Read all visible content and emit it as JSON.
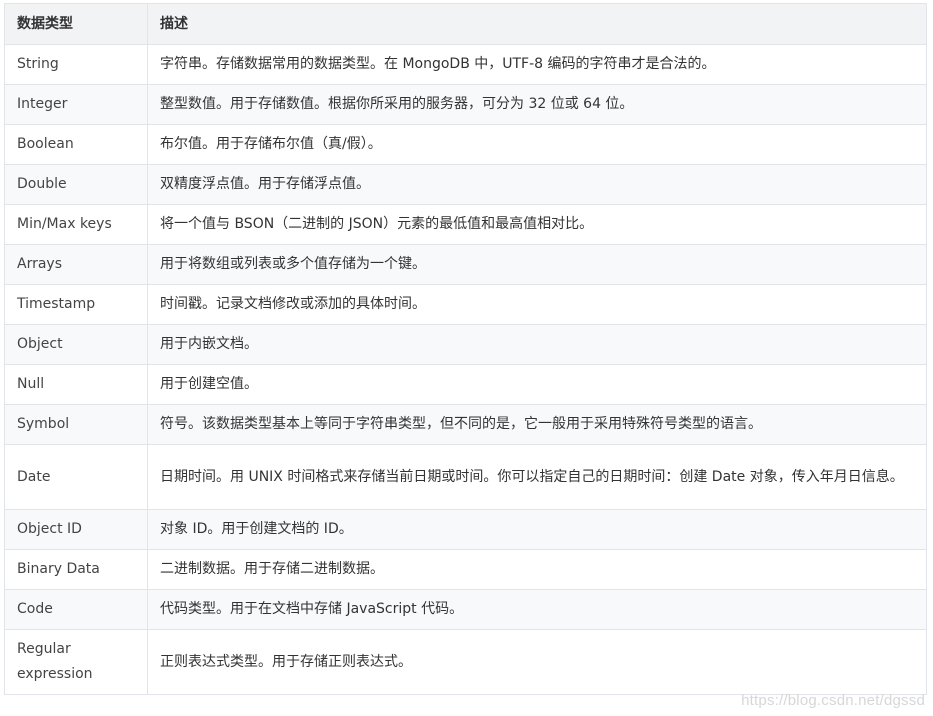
{
  "table": {
    "headers": [
      "数据类型",
      "描述"
    ],
    "rows": [
      {
        "type": "String",
        "desc": "字符串。存储数据常用的数据类型。在 MongoDB 中，UTF-8 编码的字符串才是合法的。"
      },
      {
        "type": "Integer",
        "desc": "整型数值。用于存储数值。根据你所采用的服务器，可分为 32 位或 64 位。"
      },
      {
        "type": "Boolean",
        "desc": "布尔值。用于存储布尔值（真/假）。"
      },
      {
        "type": "Double",
        "desc": "双精度浮点值。用于存储浮点值。"
      },
      {
        "type": "Min/Max keys",
        "desc": "将一个值与 BSON（二进制的 JSON）元素的最低值和最高值相对比。"
      },
      {
        "type": "Arrays",
        "desc": "用于将数组或列表或多个值存储为一个键。"
      },
      {
        "type": "Timestamp",
        "desc": "时间戳。记录文档修改或添加的具体时间。"
      },
      {
        "type": "Object",
        "desc": "用于内嵌文档。"
      },
      {
        "type": "Null",
        "desc": "用于创建空值。"
      },
      {
        "type": "Symbol",
        "desc": "符号。该数据类型基本上等同于字符串类型，但不同的是，它一般用于采用特殊符号类型的语言。"
      },
      {
        "type": "Date",
        "desc": "日期时间。用 UNIX 时间格式来存储当前日期或时间。你可以指定自己的日期时间：创建 Date 对象，传入年月日信息。"
      },
      {
        "type": "Object ID",
        "desc": "对象 ID。用于创建文档的 ID。"
      },
      {
        "type": "Binary Data",
        "desc": "二进制数据。用于存储二进制数据。"
      },
      {
        "type": "Code",
        "desc": "代码类型。用于在文档中存储 JavaScript 代码。"
      },
      {
        "type": "Regular expression",
        "desc": "正则表达式类型。用于存储正则表达式。"
      }
    ]
  },
  "watermark": "https://blog.csdn.net/dgssd"
}
